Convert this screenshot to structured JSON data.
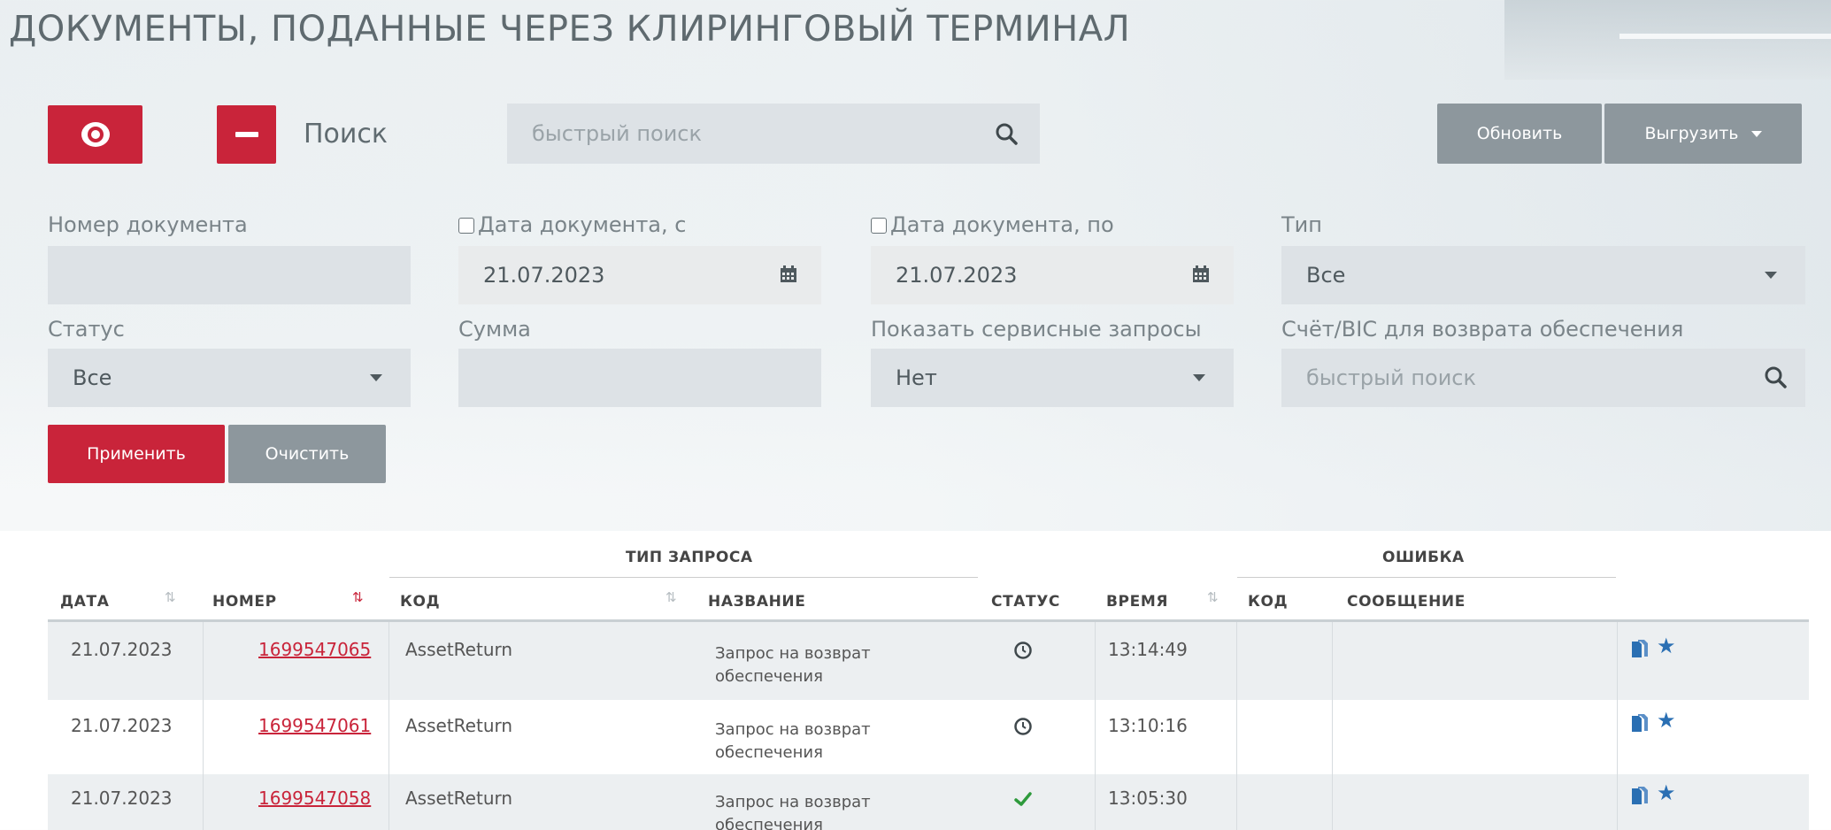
{
  "page": {
    "title": "ДОКУМЕНТЫ, ПОДАННЫЕ ЧЕРЕЗ КЛИРИНГОВЫЙ ТЕРМИНАЛ"
  },
  "toolbar": {
    "search_label": "Поиск",
    "quick_search_placeholder": "быстрый поиск",
    "refresh_label": "Обновить",
    "export_label": "Выгрузить"
  },
  "filters": {
    "doc_number_label": "Номер документа",
    "doc_number_value": "",
    "date_from_label": "Дата документа, с",
    "date_from_value": "21.07.2023",
    "date_to_label": "Дата документа, по",
    "date_to_value": "21.07.2023",
    "type_label": "Тип",
    "type_value": "Все",
    "status_label": "Статус",
    "status_value": "Все",
    "sum_label": "Сумма",
    "sum_value": "",
    "service_label": "Показать сервисные запросы",
    "service_value": "Нет",
    "account_label": "Счёт/BIC для возврата обеспечения",
    "account_placeholder": "быстрый поиск",
    "apply_label": "Применить",
    "clear_label": "Очистить"
  },
  "table": {
    "group_request_type": "ТИП ЗАПРОСА",
    "group_error": "ОШИБКА",
    "columns": {
      "date": "ДАТА",
      "number": "НОМЕР",
      "code": "КОД",
      "name": "НАЗВАНИЕ",
      "status": "СТАТУС",
      "time": "ВРЕМЯ",
      "err_code": "КОД",
      "message": "СООБЩЕНИЕ"
    },
    "rows": [
      {
        "date": "21.07.2023",
        "number": "1699547065",
        "code": "AssetReturn",
        "name": "Запрос на возврат обеспечения",
        "status_icon": "clock-icon",
        "time": "13:14:49",
        "err_code": "",
        "message": ""
      },
      {
        "date": "21.07.2023",
        "number": "1699547061",
        "code": "AssetReturn",
        "name": "Запрос на возврат обеспечения",
        "status_icon": "clock-icon",
        "time": "13:10:16",
        "err_code": "",
        "message": ""
      },
      {
        "date": "21.07.2023",
        "number": "1699547058",
        "code": "AssetReturn",
        "name": "Запрос на возврат обеспечения",
        "status_icon": "check-icon",
        "time": "13:05:30",
        "err_code": "",
        "message": ""
      }
    ]
  },
  "colors": {
    "accent": "#c9243a",
    "grey_button": "#8d979d",
    "field_bg": "#dde2e6",
    "success": "#2e9a3c",
    "star": "#2a6fb3"
  }
}
